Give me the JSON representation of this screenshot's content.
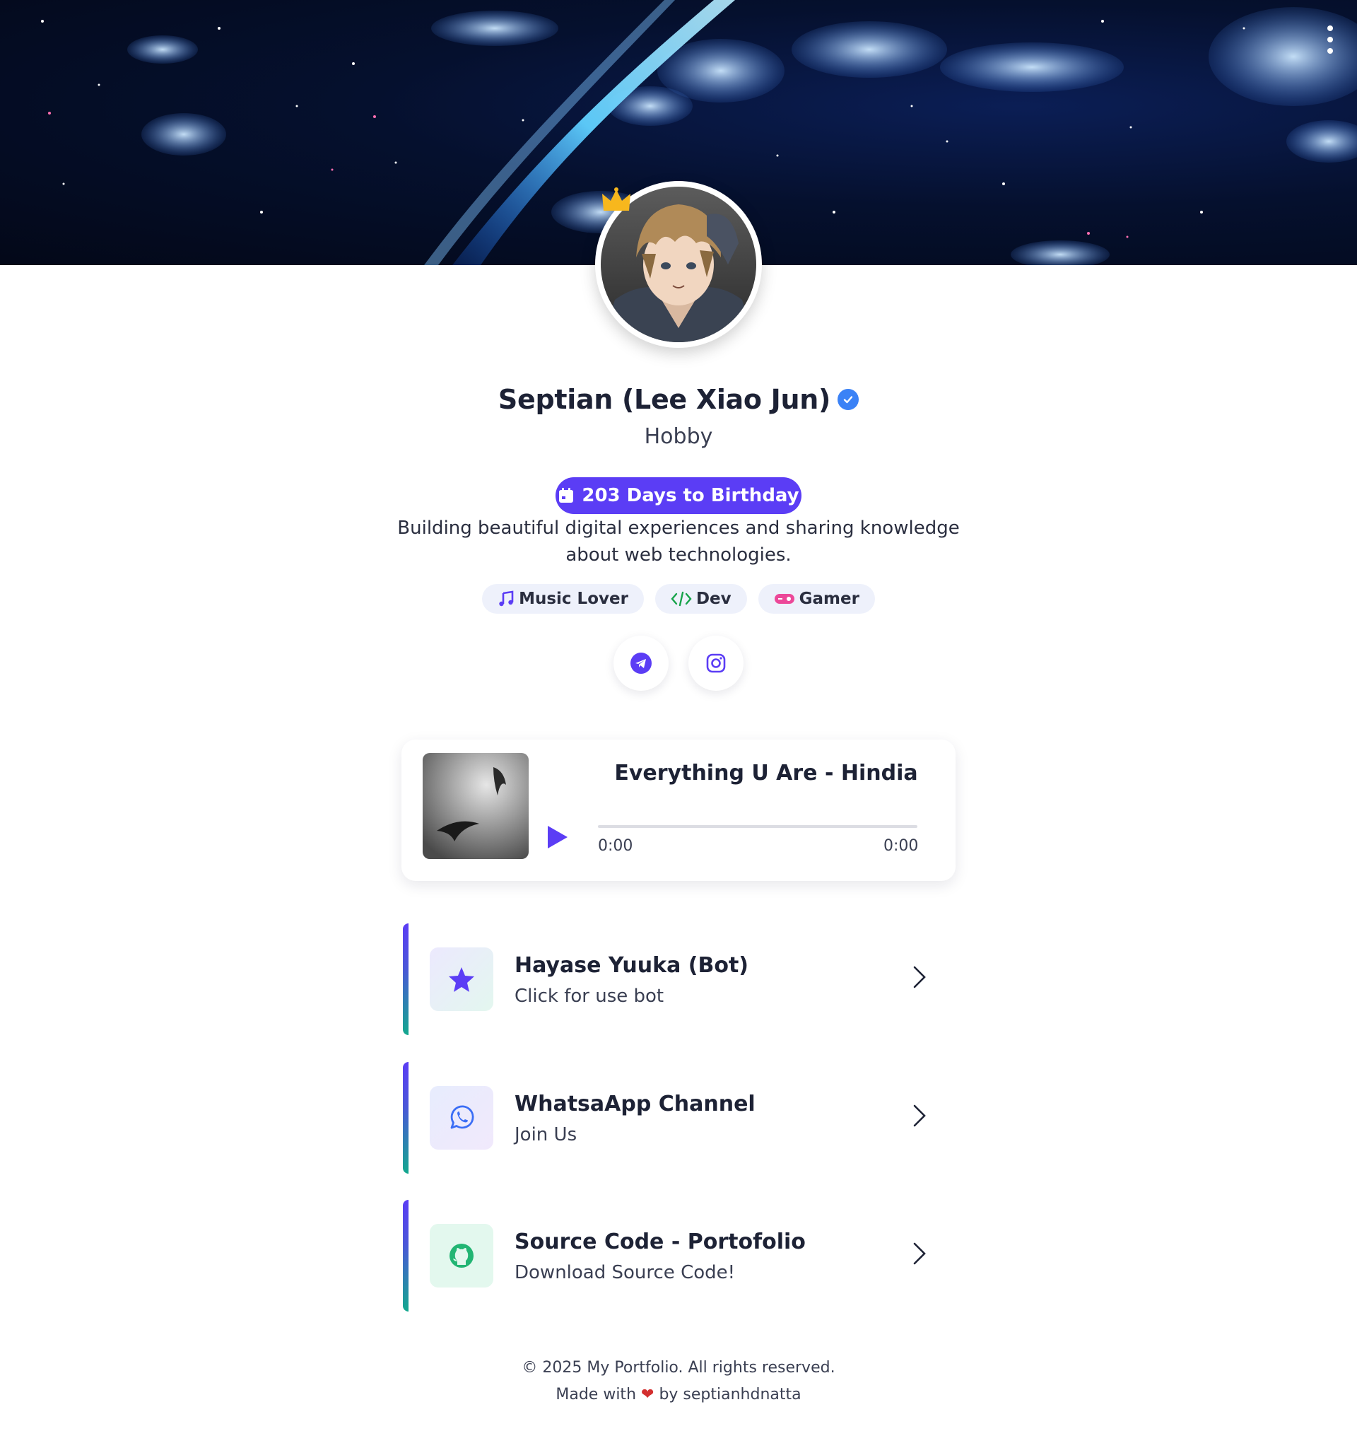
{
  "banner": {
    "menu_icon": "more-vertical-icon"
  },
  "profile": {
    "name": "Septian (Lee Xiao Jun)",
    "verified_icon": "verified-badge-icon",
    "subtitle": "Hobby",
    "birthday_label": "203 Days to Birthday",
    "bio": "Building beautiful digital experiences and sharing knowledge about web technologies."
  },
  "tags": [
    {
      "label": "Music Lover",
      "icon": "music-note-icon",
      "color": "#5b3df5"
    },
    {
      "label": "Dev",
      "icon": "code-icon",
      "color": "#16a34a"
    },
    {
      "label": "Gamer",
      "icon": "gamepad-icon",
      "color": "#ec4899"
    }
  ],
  "socials": [
    {
      "name": "telegram",
      "icon": "telegram-icon"
    },
    {
      "name": "instagram",
      "icon": "instagram-icon"
    }
  ],
  "player": {
    "title": "Everything U Are - Hindia",
    "current_time": "0:00",
    "duration": "0:00",
    "progress": 0
  },
  "links": [
    {
      "title": "Hayase Yuuka (Bot)",
      "subtitle": "Click for use bot",
      "icon": "star-icon"
    },
    {
      "title": "WhatsaApp Channel",
      "subtitle": "Join Us",
      "icon": "whatsapp-icon"
    },
    {
      "title": "Source Code - Portofolio",
      "subtitle": "Download Source Code!",
      "icon": "github-icon"
    }
  ],
  "footer": {
    "copyright": "© 2025 My Portfolio. All rights reserved.",
    "made_with_prefix": "Made with",
    "made_with_suffix": "by septianhdnatta"
  },
  "colors": {
    "accent": "#5b3df5",
    "verified": "#3b82f6",
    "text_dark": "#1d2235"
  }
}
